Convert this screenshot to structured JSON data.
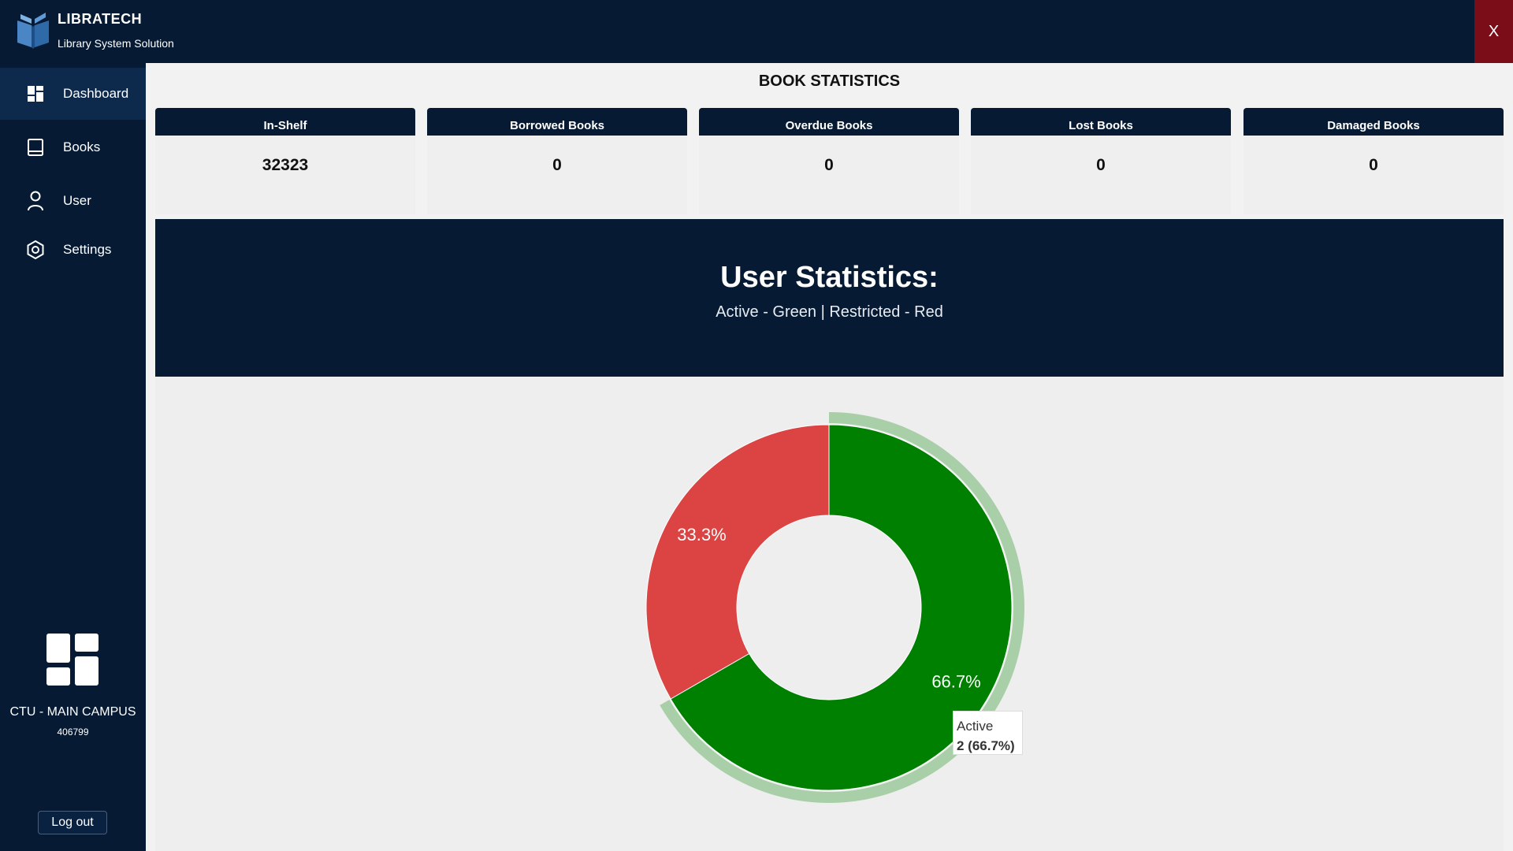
{
  "app": {
    "title": "LIBRATECH",
    "subtitle": "Library System Solution",
    "close_label": "X"
  },
  "sidebar": {
    "items": [
      {
        "label": "Dashboard",
        "icon": "dashboard-icon",
        "active": true
      },
      {
        "label": "Books",
        "icon": "book-icon",
        "active": false
      },
      {
        "label": "User",
        "icon": "user-icon",
        "active": false
      },
      {
        "label": "Settings",
        "icon": "settings-icon",
        "active": false
      }
    ],
    "campus_name": "CTU - MAIN CAMPUS",
    "campus_code": "406799",
    "logout_label": "Log out"
  },
  "book_stats": {
    "title": "BOOK STATISTICS",
    "cards": [
      {
        "label": "In-Shelf",
        "value": "32323"
      },
      {
        "label": "Borrowed Books",
        "value": "0"
      },
      {
        "label": "Overdue Books",
        "value": "0"
      },
      {
        "label": "Lost Books",
        "value": "0"
      },
      {
        "label": "Damaged Books",
        "value": "0"
      }
    ]
  },
  "user_stats": {
    "title": "User Statistics:",
    "legend_text": "Active - Green | Restricted - Red"
  },
  "chart_data": {
    "type": "pie",
    "labels": [
      "Active",
      "Restricted"
    ],
    "values": [
      2,
      1
    ],
    "percent_labels": [
      "66.7%",
      "33.3%"
    ],
    "colors": [
      "#008000",
      "#dc4444"
    ],
    "hover_color": "#a8cfa8",
    "tooltip": {
      "label": "Active",
      "value": "2 (66.7%)"
    }
  },
  "colors": {
    "navy": "#061a33",
    "close_red": "#7a0d18"
  }
}
